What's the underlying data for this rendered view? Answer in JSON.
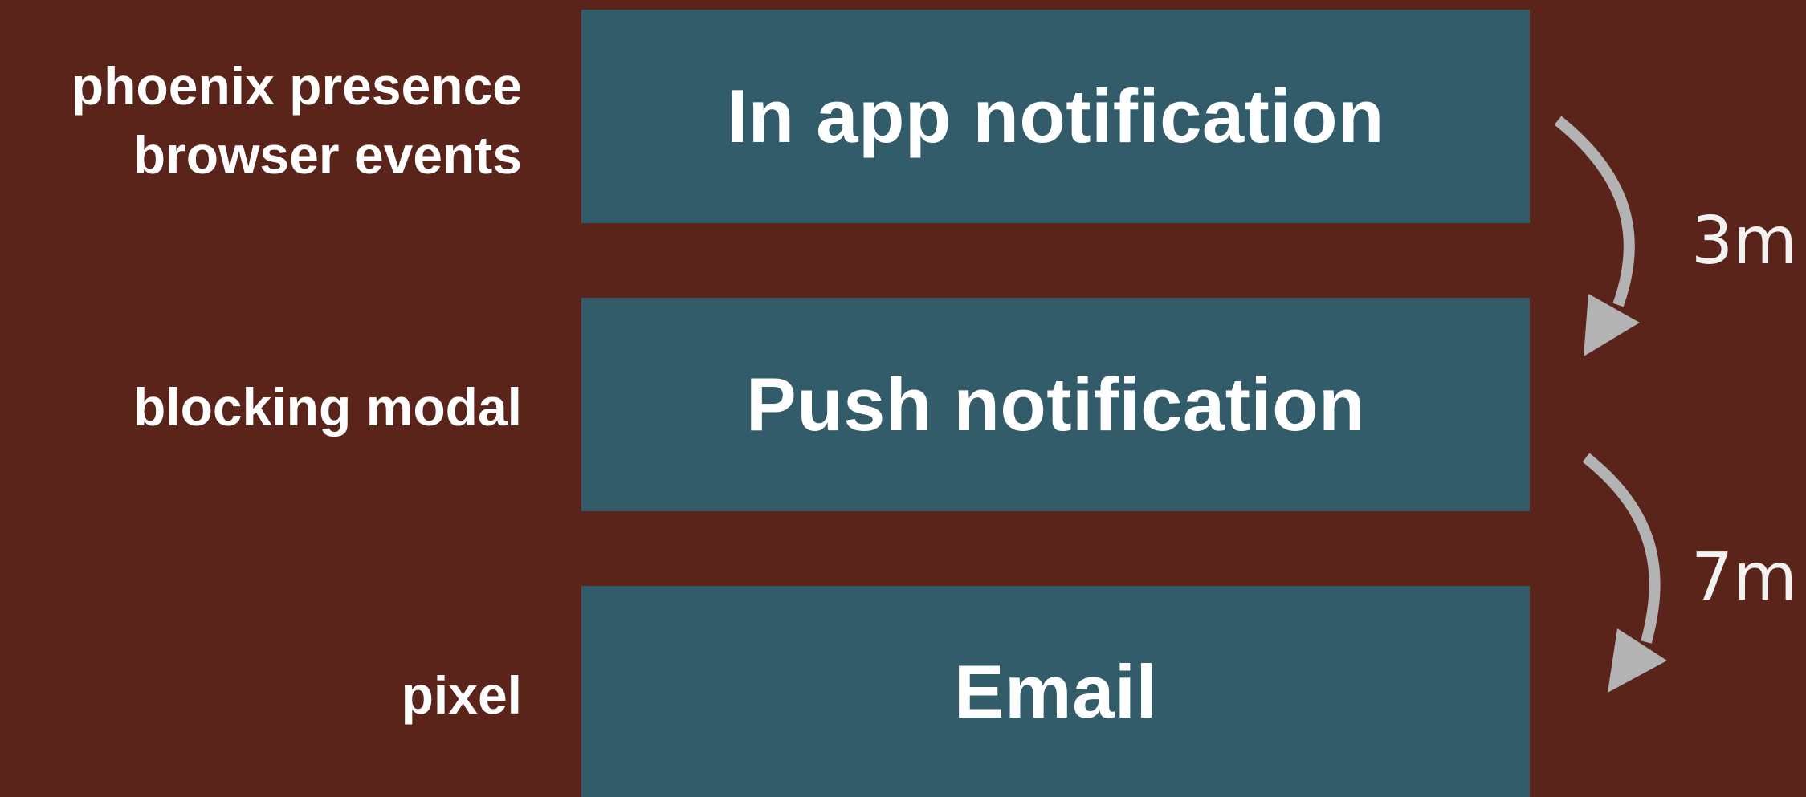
{
  "channels": [
    {
      "title": "In app notification",
      "detection_lines": [
        "phoenix presence",
        "browser events"
      ]
    },
    {
      "title": "Push notification",
      "detection_lines": [
        "blocking modal"
      ]
    },
    {
      "title": "Email",
      "detection_lines": [
        "pixel"
      ]
    }
  ],
  "escalations": [
    {
      "delay": "3m"
    },
    {
      "delay": "7m"
    }
  ],
  "colors": {
    "background": "#5a241b",
    "box": "#335c6b",
    "text": "#ffffff",
    "arrow": "#b3b3b3"
  },
  "icons": {
    "escalation_arrow": "curved-down-arrow-icon"
  }
}
